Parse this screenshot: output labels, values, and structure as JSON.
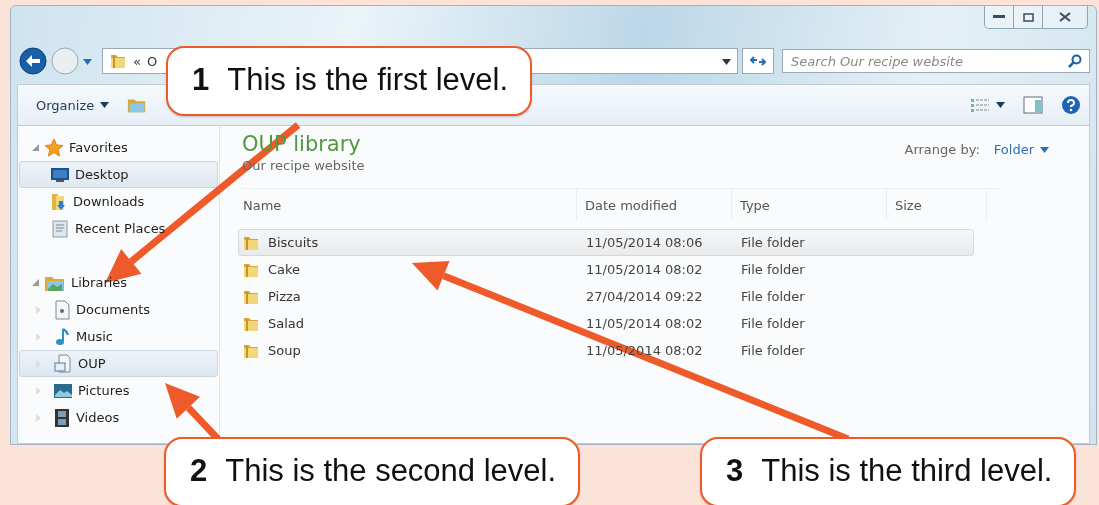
{
  "window": {
    "address": {
      "chevron": "«",
      "text": "O"
    },
    "search": {
      "placeholder": "Search Our recipe website"
    }
  },
  "toolbar": {
    "organize": "Organize"
  },
  "nav_pane": [
    {
      "label": "Favorites",
      "kind": "group",
      "expanded": true,
      "children": [
        {
          "label": "Desktop",
          "kind": "item",
          "selected": true
        },
        {
          "label": "Downloads",
          "kind": "item",
          "selected": false
        },
        {
          "label": "Recent Places",
          "kind": "item",
          "selected": false
        }
      ]
    },
    {
      "label": "Libraries",
      "kind": "group",
      "expanded": true,
      "children": [
        {
          "label": "Documents",
          "kind": "item",
          "selected": false
        },
        {
          "label": "Music",
          "kind": "item",
          "selected": false
        },
        {
          "label": "OUP",
          "kind": "item",
          "selected": true
        },
        {
          "label": "Pictures",
          "kind": "item",
          "selected": false
        },
        {
          "label": "Videos",
          "kind": "item",
          "selected": false
        }
      ]
    }
  ],
  "library": {
    "title": "OUP library",
    "subtitle": "Our recipe website",
    "arrange_label": "Arrange by:",
    "arrange_value": "Folder"
  },
  "table": {
    "columns": [
      "Name",
      "Date modified",
      "Type",
      "Size"
    ],
    "rows": [
      {
        "name": "Biscuits",
        "date": "11/05/2014 08:06",
        "type": "File folder",
        "selected": true
      },
      {
        "name": "Cake",
        "date": "11/05/2014 08:02",
        "type": "File folder",
        "selected": false
      },
      {
        "name": "Pizza",
        "date": "27/04/2014 09:22",
        "type": "File folder",
        "selected": false
      },
      {
        "name": "Salad",
        "date": "11/05/2014 08:02",
        "type": "File folder",
        "selected": false
      },
      {
        "name": "Soup",
        "date": "11/05/2014 08:02",
        "type": "File folder",
        "selected": false
      }
    ]
  },
  "callouts": [
    {
      "number": "1",
      "text": "This is the first level."
    },
    {
      "number": "2",
      "text": "This is the second level."
    },
    {
      "number": "3",
      "text": "This is the third level."
    }
  ]
}
